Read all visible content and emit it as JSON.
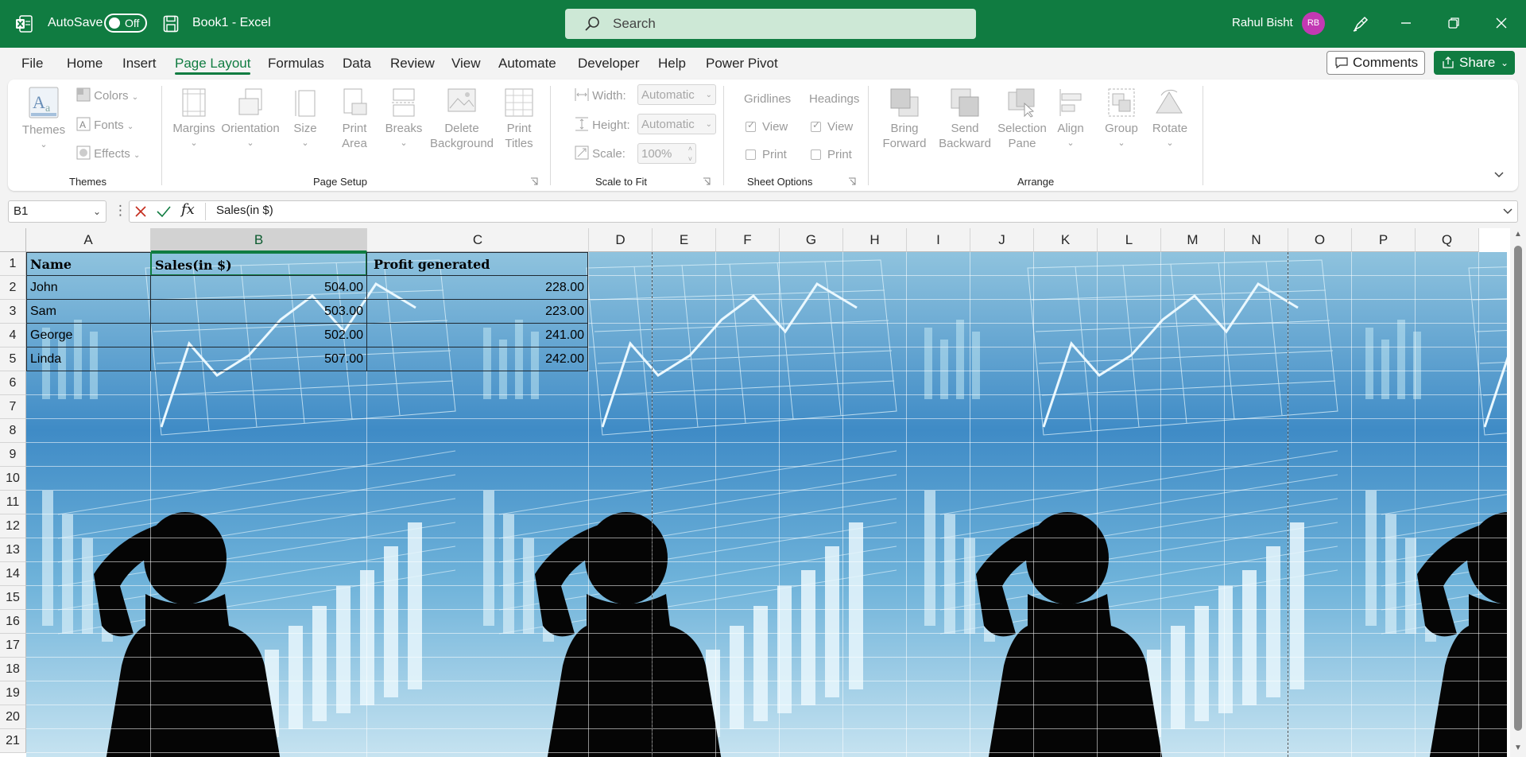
{
  "titlebar": {
    "autosave_label": "AutoSave",
    "autosave_state": "Off",
    "doc_title": "Book1  -  Excel",
    "search_placeholder": "Search",
    "user_name": "Rahul Bisht",
    "user_initials": "RB"
  },
  "menu": {
    "items": [
      "File",
      "Home",
      "Insert",
      "Page Layout",
      "Formulas",
      "Data",
      "Review",
      "View",
      "Automate",
      "Developer",
      "Help",
      "Power Pivot"
    ],
    "active": "Page Layout",
    "comments_label": "Comments",
    "share_label": "Share"
  },
  "ribbon": {
    "themes": {
      "themes_label": "Themes",
      "colors_label": "Colors",
      "fonts_label": "Fonts",
      "effects_label": "Effects",
      "group_label": "Themes"
    },
    "page_setup": {
      "margins": "Margins",
      "orientation": "Orientation",
      "size": "Size",
      "print_area_1": "Print",
      "print_area_2": "Area",
      "breaks": "Breaks",
      "delete_bg_1": "Delete",
      "delete_bg_2": "Background",
      "print_titles_1": "Print",
      "print_titles_2": "Titles",
      "group_label": "Page Setup"
    },
    "scale_to_fit": {
      "width_label": "Width:",
      "width_value": "Automatic",
      "height_label": "Height:",
      "height_value": "Automatic",
      "scale_label": "Scale:",
      "scale_value": "100%",
      "group_label": "Scale to Fit"
    },
    "sheet_options": {
      "gridlines_label": "Gridlines",
      "headings_label": "Headings",
      "view_label": "View",
      "print_label": "Print",
      "gridlines_view": true,
      "gridlines_print": false,
      "headings_view": true,
      "headings_print": false,
      "group_label": "Sheet Options"
    },
    "arrange": {
      "bring_forward_1": "Bring",
      "bring_forward_2": "Forward",
      "send_backward_1": "Send",
      "send_backward_2": "Backward",
      "selection_pane_1": "Selection",
      "selection_pane_2": "Pane",
      "align": "Align",
      "group": "Group",
      "rotate": "Rotate",
      "group_label": "Arrange"
    }
  },
  "formula_bar": {
    "name_box": "B1",
    "formula": "Sales(in $)"
  },
  "sheet": {
    "columns": [
      "A",
      "B",
      "C",
      "D",
      "E",
      "F",
      "G",
      "H",
      "I",
      "J",
      "K",
      "L",
      "M",
      "N",
      "O",
      "P",
      "Q"
    ],
    "selected_column": "B",
    "rows": [
      "1",
      "2",
      "3",
      "4",
      "5",
      "6",
      "7",
      "8",
      "9",
      "10",
      "11",
      "12",
      "13",
      "14",
      "15",
      "16",
      "17",
      "18",
      "19",
      "20",
      "21"
    ],
    "header": [
      "Name",
      "Sales(in $)",
      "Profit generated"
    ],
    "data": [
      [
        "John",
        "504.00",
        "228.00"
      ],
      [
        "Sam",
        "503.00",
        "223.00"
      ],
      [
        "George",
        "502.00",
        "241.00"
      ],
      [
        "Linda",
        "507.00",
        "242.00"
      ]
    ]
  },
  "colors": {
    "excel_green": "#107c41",
    "search_bg": "#cde8d6",
    "avatar": "#c239b3"
  }
}
